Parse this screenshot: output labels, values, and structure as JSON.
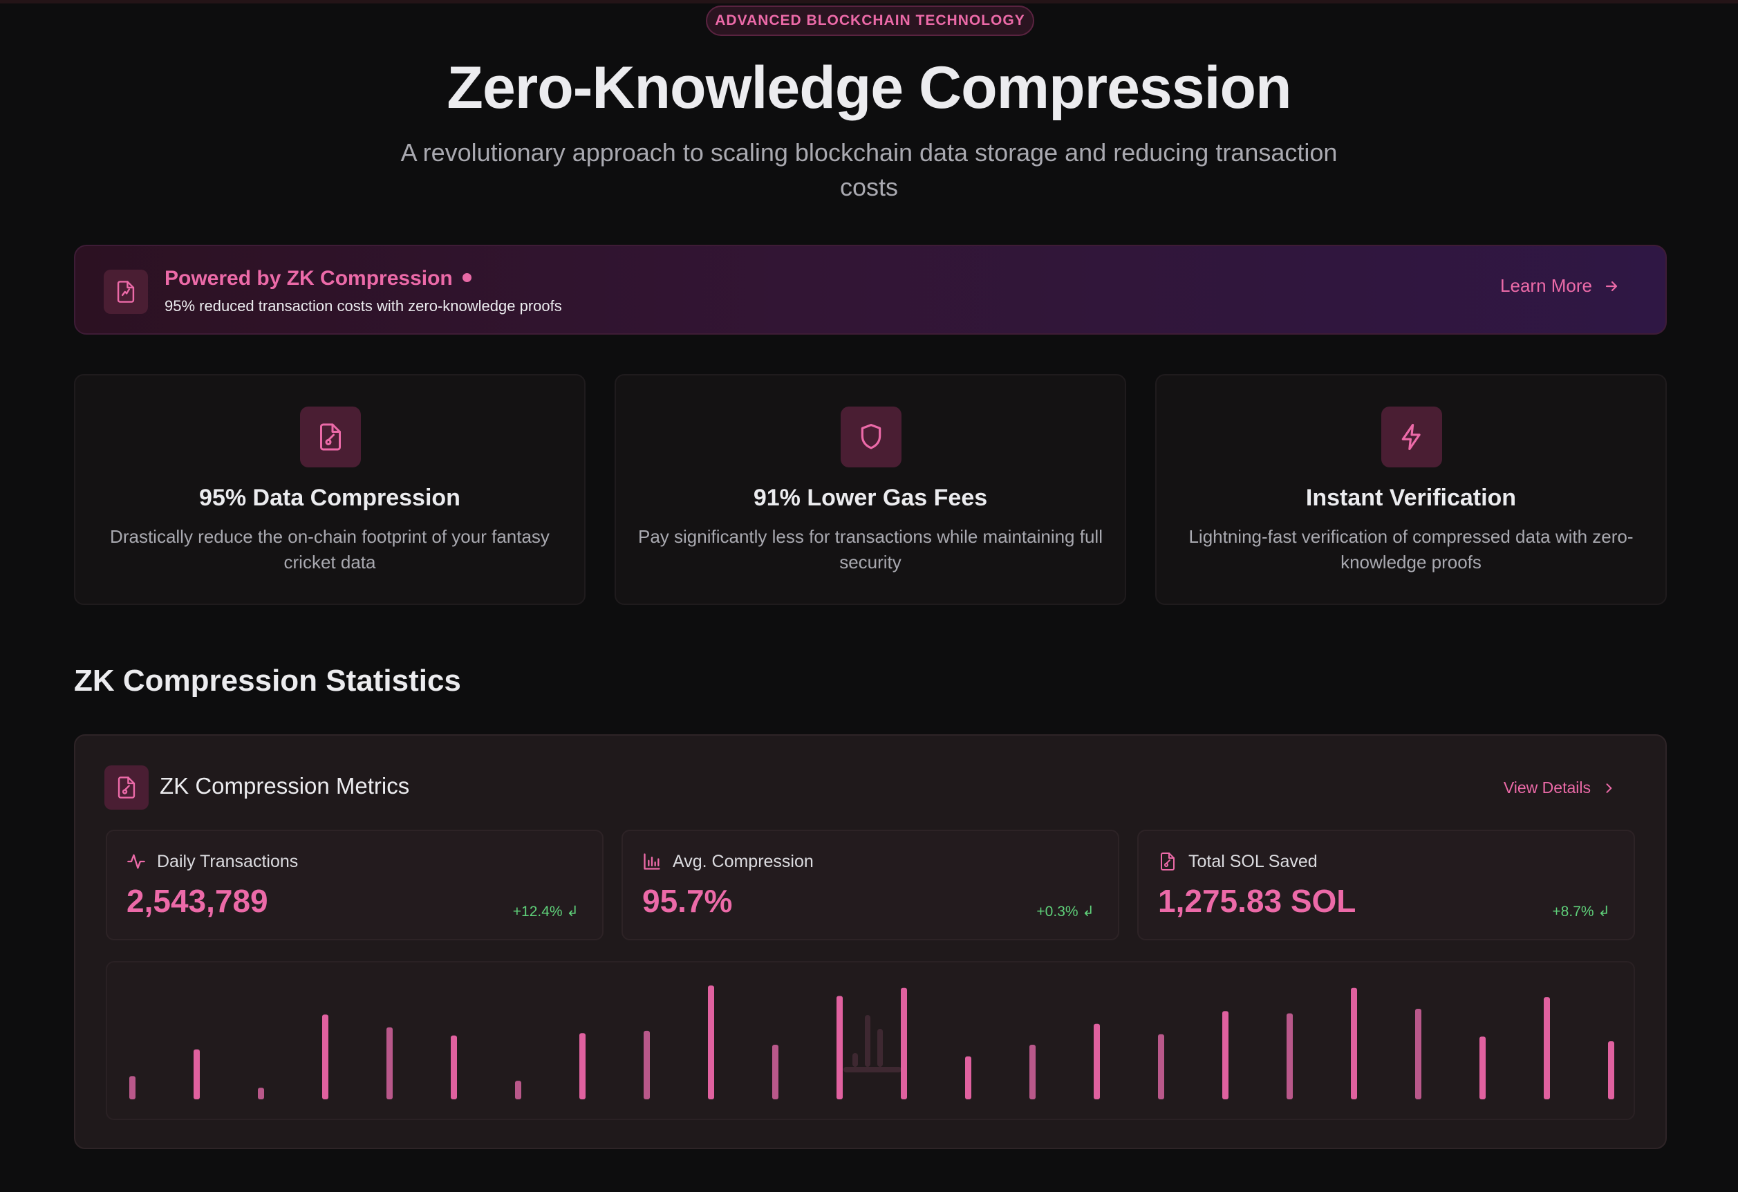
{
  "hero": {
    "badge": "ADVANCED BLOCKCHAIN TECHNOLOGY",
    "title": "Zero-Knowledge Compression",
    "subtitle": "A revolutionary approach to scaling blockchain data storage and reducing transaction costs"
  },
  "banner": {
    "icon": "file-check-icon",
    "title": "Powered by ZK Compression",
    "subtitle": "95% reduced transaction costs with zero-knowledge proofs",
    "link_label": "Learn More"
  },
  "features": [
    {
      "icon": "file-check-icon",
      "title": "95% Data Compression",
      "description": "Drastically reduce the on-chain footprint of your fantasy cricket data"
    },
    {
      "icon": "shield-icon",
      "title": "91% Lower Gas Fees",
      "description": "Pay significantly less for transactions while maintaining full security"
    },
    {
      "icon": "lightning-icon",
      "title": "Instant Verification",
      "description": "Lightning-fast verification of compressed data with zero-knowledge proofs"
    }
  ],
  "section_title": "ZK Compression Statistics",
  "metrics": {
    "title": "ZK Compression Metrics",
    "link_label": "View Details",
    "stats": [
      {
        "icon": "activity-icon",
        "label": "Daily Transactions",
        "value": "2,543,789",
        "change": "+12.4%"
      },
      {
        "icon": "bar-chart-icon",
        "label": "Avg. Compression",
        "value": "95.7%",
        "change": "+0.3%"
      },
      {
        "icon": "file-check-icon",
        "label": "Total SOL Saved",
        "value": "1,275.83 SOL",
        "change": "+8.7%"
      }
    ]
  },
  "colors": {
    "accent": "#ec6aa8",
    "positive": "#5fd17a",
    "background": "#0d0d0e"
  },
  "chart_data": {
    "type": "bar",
    "title": "",
    "xlabel": "",
    "ylabel": "",
    "ylim": [
      0,
      100
    ],
    "values": [
      20,
      43,
      10,
      73,
      62,
      55,
      16,
      57,
      59,
      98,
      47,
      89,
      96,
      37,
      47,
      65,
      56,
      76,
      74,
      96,
      78,
      54,
      88,
      50
    ]
  }
}
